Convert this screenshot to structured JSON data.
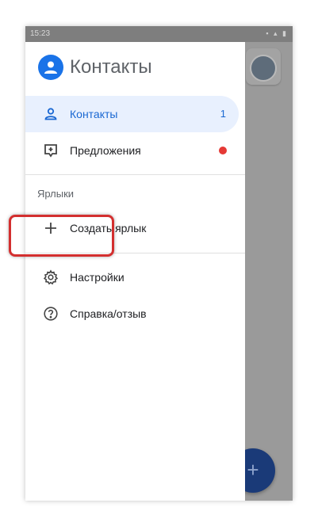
{
  "status_bar": {
    "time": "15:23"
  },
  "drawer": {
    "title": "Контакты",
    "items": [
      {
        "label": "Контакты",
        "count": "1",
        "icon": "person-icon",
        "active": true
      },
      {
        "label": "Предложения",
        "icon": "suggestions-icon",
        "badge_color": "#e53935"
      }
    ],
    "labels_section": "Ярлыки",
    "create_label": "Создать ярлык",
    "settings": "Настройки",
    "help": "Справка/отзыв"
  },
  "fab": {
    "icon": "add-icon",
    "symbol": "+"
  },
  "colors": {
    "accent": "#1a73e8",
    "active_bg": "#e8f0fe",
    "highlight_border": "#d32f2f",
    "fab": "#1a3a78"
  }
}
